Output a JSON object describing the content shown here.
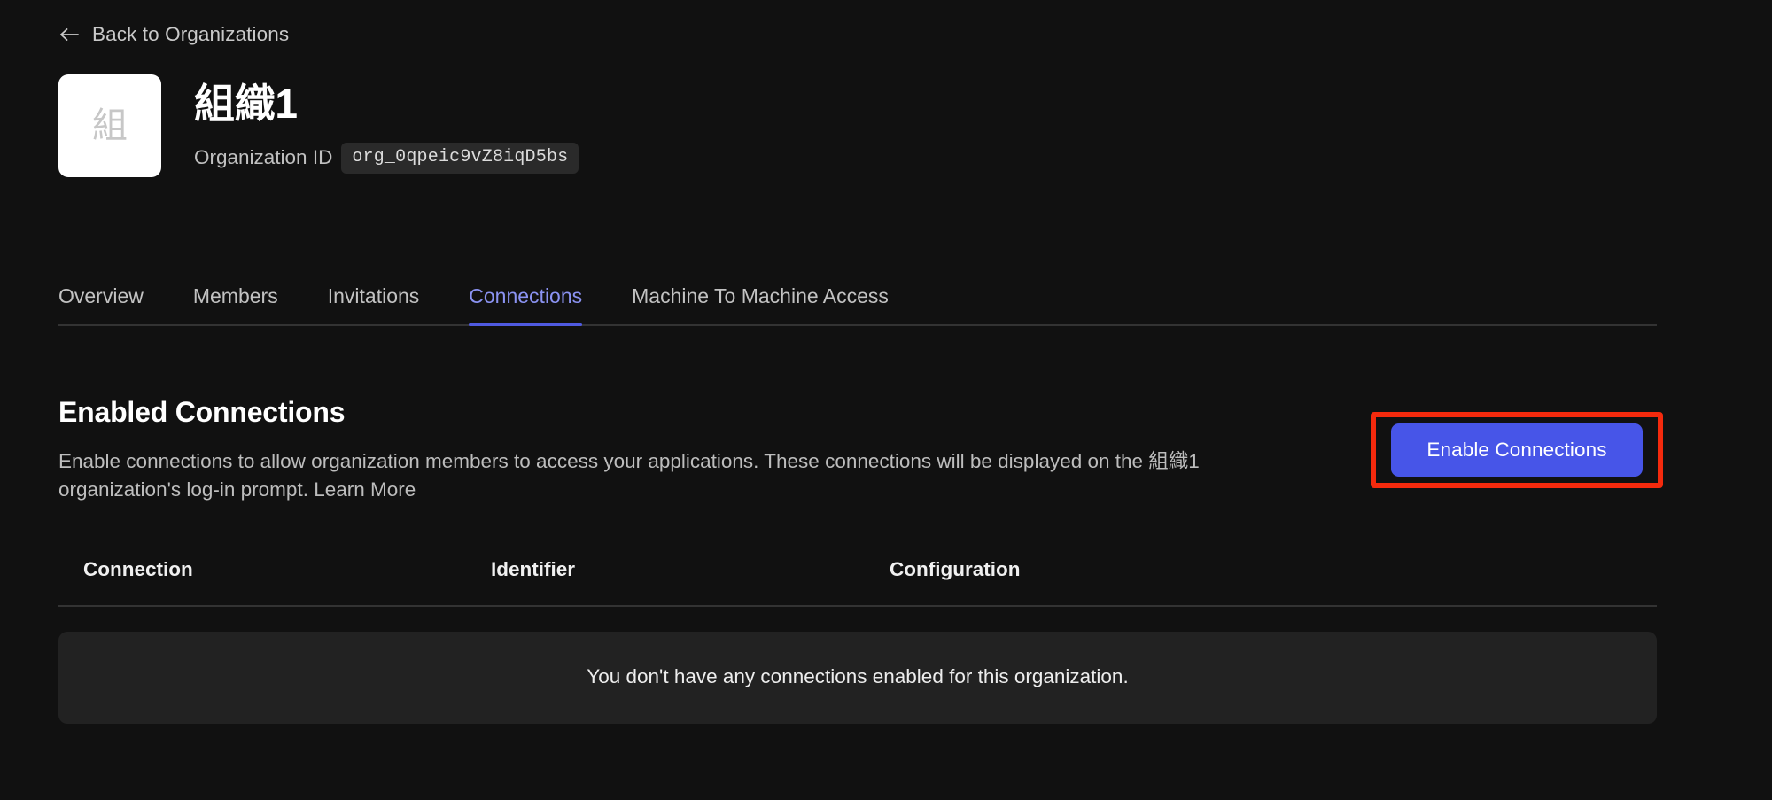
{
  "back_nav": {
    "icon": "arrow-left-icon",
    "label": "Back to Organizations"
  },
  "organization": {
    "avatar_letter": "組",
    "name": "組織1",
    "id_label": "Organization ID",
    "id_value": "org_0qpeic9vZ8iqD5bs"
  },
  "tabs": [
    {
      "label": "Overview",
      "active": false
    },
    {
      "label": "Members",
      "active": false
    },
    {
      "label": "Invitations",
      "active": false
    },
    {
      "label": "Connections",
      "active": true
    },
    {
      "label": "Machine To Machine Access",
      "active": false
    }
  ],
  "section": {
    "title": "Enabled Connections",
    "description_part1": "Enable connections to allow organization members to access your applications. These connections will be displayed on the 組織1 organization's log-in prompt. ",
    "learn_more": "Learn More"
  },
  "primary_button": {
    "label": "Enable Connections",
    "color": "#4755e8",
    "highlight_color": "#f52a0d"
  },
  "table": {
    "columns": [
      "Connection",
      "Identifier",
      "Configuration"
    ],
    "rows": [],
    "empty_message": "You don't have any connections enabled for this organization."
  },
  "colors": {
    "background": "#111111",
    "accent": "#4755e8",
    "active_tab": "#8b93f2",
    "empty_panel": "#222222",
    "divider": "#333333"
  }
}
